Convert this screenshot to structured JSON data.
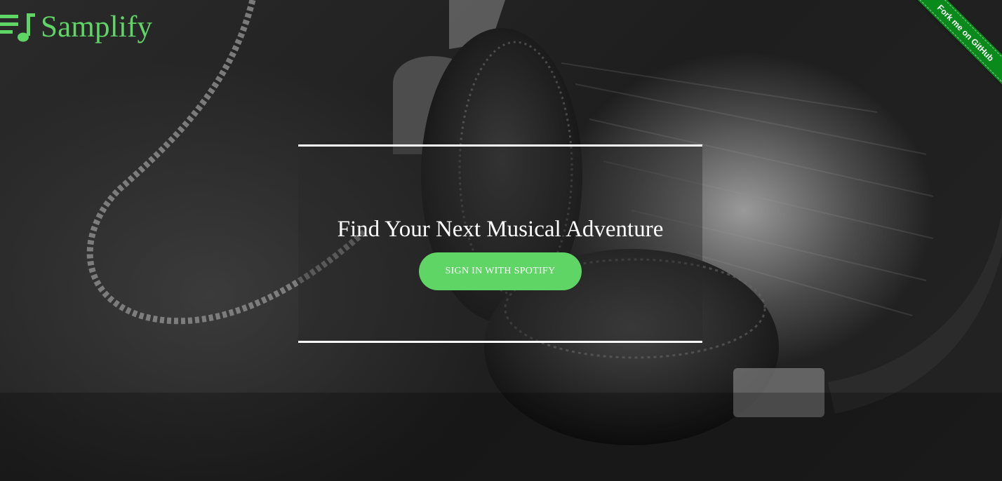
{
  "brand": {
    "name": "Samplify",
    "logo_icon": "playlist-music-icon",
    "color": "#5fd565"
  },
  "ribbon": {
    "label": "Fork me on GitHub",
    "color": "#0b8a1c"
  },
  "hero": {
    "title": "Find Your Next Musical Adventure",
    "signin_label": "SIGN IN WITH SPOTIFY",
    "button_color": "#5fd565"
  },
  "background": {
    "image": "headphones-photo"
  }
}
